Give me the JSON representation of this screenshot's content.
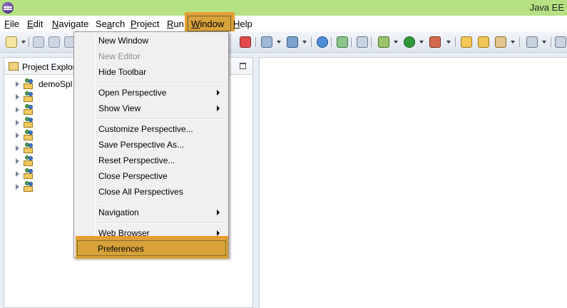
{
  "window": {
    "title": "Java EE"
  },
  "menubar": {
    "items": [
      {
        "label": "File",
        "u": "F",
        "rest": "ile"
      },
      {
        "label": "Edit",
        "u": "E",
        "rest": "dit"
      },
      {
        "label": "Navigate",
        "u": "N",
        "rest": "avigate"
      },
      {
        "label": "Search",
        "pre": "Se",
        "u": "a",
        "rest": "rch"
      },
      {
        "label": "Project",
        "u": "P",
        "rest": "roject"
      },
      {
        "label": "Run",
        "u": "R",
        "rest": "un"
      },
      {
        "label": "Window",
        "u": "W",
        "rest": "indow"
      },
      {
        "label": "Help",
        "u": "H",
        "rest": "elp"
      }
    ]
  },
  "explorer": {
    "title": "Project Explor",
    "projects": [
      "demoSpl",
      "",
      "",
      "",
      "",
      "",
      "",
      "",
      ""
    ]
  },
  "window_menu": {
    "items": [
      {
        "label": "New Window",
        "enabled": true
      },
      {
        "label": "New Editor",
        "enabled": false
      },
      {
        "label": "Hide Toolbar",
        "enabled": true
      },
      {
        "label": "Open Perspective",
        "submenu": true
      },
      {
        "label": "Show View",
        "submenu": true
      },
      {
        "label": "Customize Perspective...",
        "enabled": true
      },
      {
        "label": "Save Perspective As...",
        "enabled": true
      },
      {
        "label": "Reset Perspective...",
        "enabled": true
      },
      {
        "label": "Close Perspective",
        "enabled": true
      },
      {
        "label": "Close All Perspectives",
        "enabled": true
      },
      {
        "label": "Navigation",
        "submenu": true
      },
      {
        "label": "Web Browser",
        "submenu": true
      },
      {
        "label": "Preferences",
        "enabled": true,
        "highlighted": true
      }
    ]
  },
  "colors": {
    "titlebar": "#b5e183",
    "highlight": "#d7a23a",
    "highlight_border": "#f09b2b"
  }
}
